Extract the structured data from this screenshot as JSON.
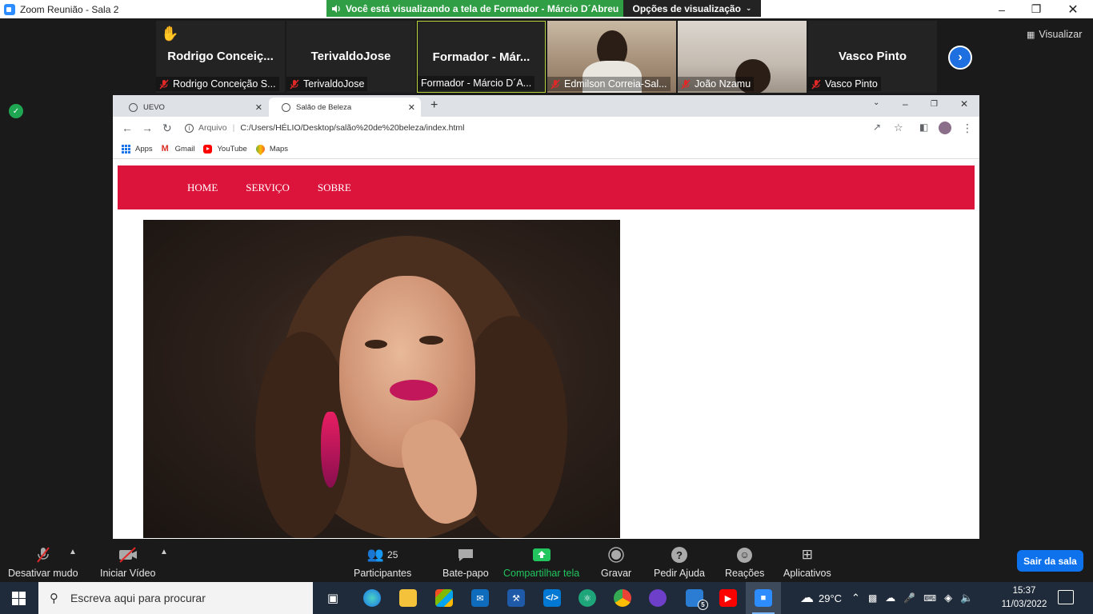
{
  "window": {
    "title": "Zoom Reunião - Sala 2",
    "share_banner": "Você está visualizando a tela de Formador - Márcio D´Abreu",
    "view_options": "Opções de visualização"
  },
  "participants": [
    {
      "display": "Rodrigo  Conceiç...",
      "label": "Rodrigo Conceição S...",
      "hand_raised": true
    },
    {
      "display": "TerivaldoJose",
      "label": "TerivaldoJose"
    },
    {
      "display": "Formador  -  Már...",
      "label": "Formador - Márcio D´A...",
      "active": true
    },
    {
      "display": "",
      "label": "Edmilson Correia-Sal...",
      "video": true
    },
    {
      "display": "",
      "label": "João Nzamu",
      "video": true
    },
    {
      "display": "Vasco Pinto",
      "label": "Vasco Pinto"
    }
  ],
  "visualizar_label": "Visualizar",
  "browser": {
    "tabs": [
      {
        "title": "UEVO"
      },
      {
        "title": "Salão de Beleza",
        "active": true
      }
    ],
    "url_prefix": "Arquivo",
    "url": "C:/Users/HÉLIO/Desktop/salão%20de%20beleza/index.html",
    "bookmarks": [
      "Apps",
      "Gmail",
      "YouTube",
      "Maps"
    ]
  },
  "site": {
    "nav": [
      "HOME",
      "SERVIÇO",
      "SOBRE"
    ],
    "colors": {
      "nav_bg": "#dc143c"
    }
  },
  "toolbar": {
    "mute": "Desativar mudo",
    "video": "Iniciar Vídeo",
    "participants": "Participantes",
    "participants_count": "25",
    "chat": "Bate-papo",
    "share": "Compartilhar tela",
    "record": "Gravar",
    "help": "Pedir Ajuda",
    "reactions": "Reações",
    "apps": "Aplicativos",
    "leave": "Sair da sala"
  },
  "taskbar": {
    "search_placeholder": "Escreva aqui para procurar",
    "weather": "29°C",
    "time": "15:37",
    "date": "11/03/2022",
    "word_badge": "5"
  }
}
